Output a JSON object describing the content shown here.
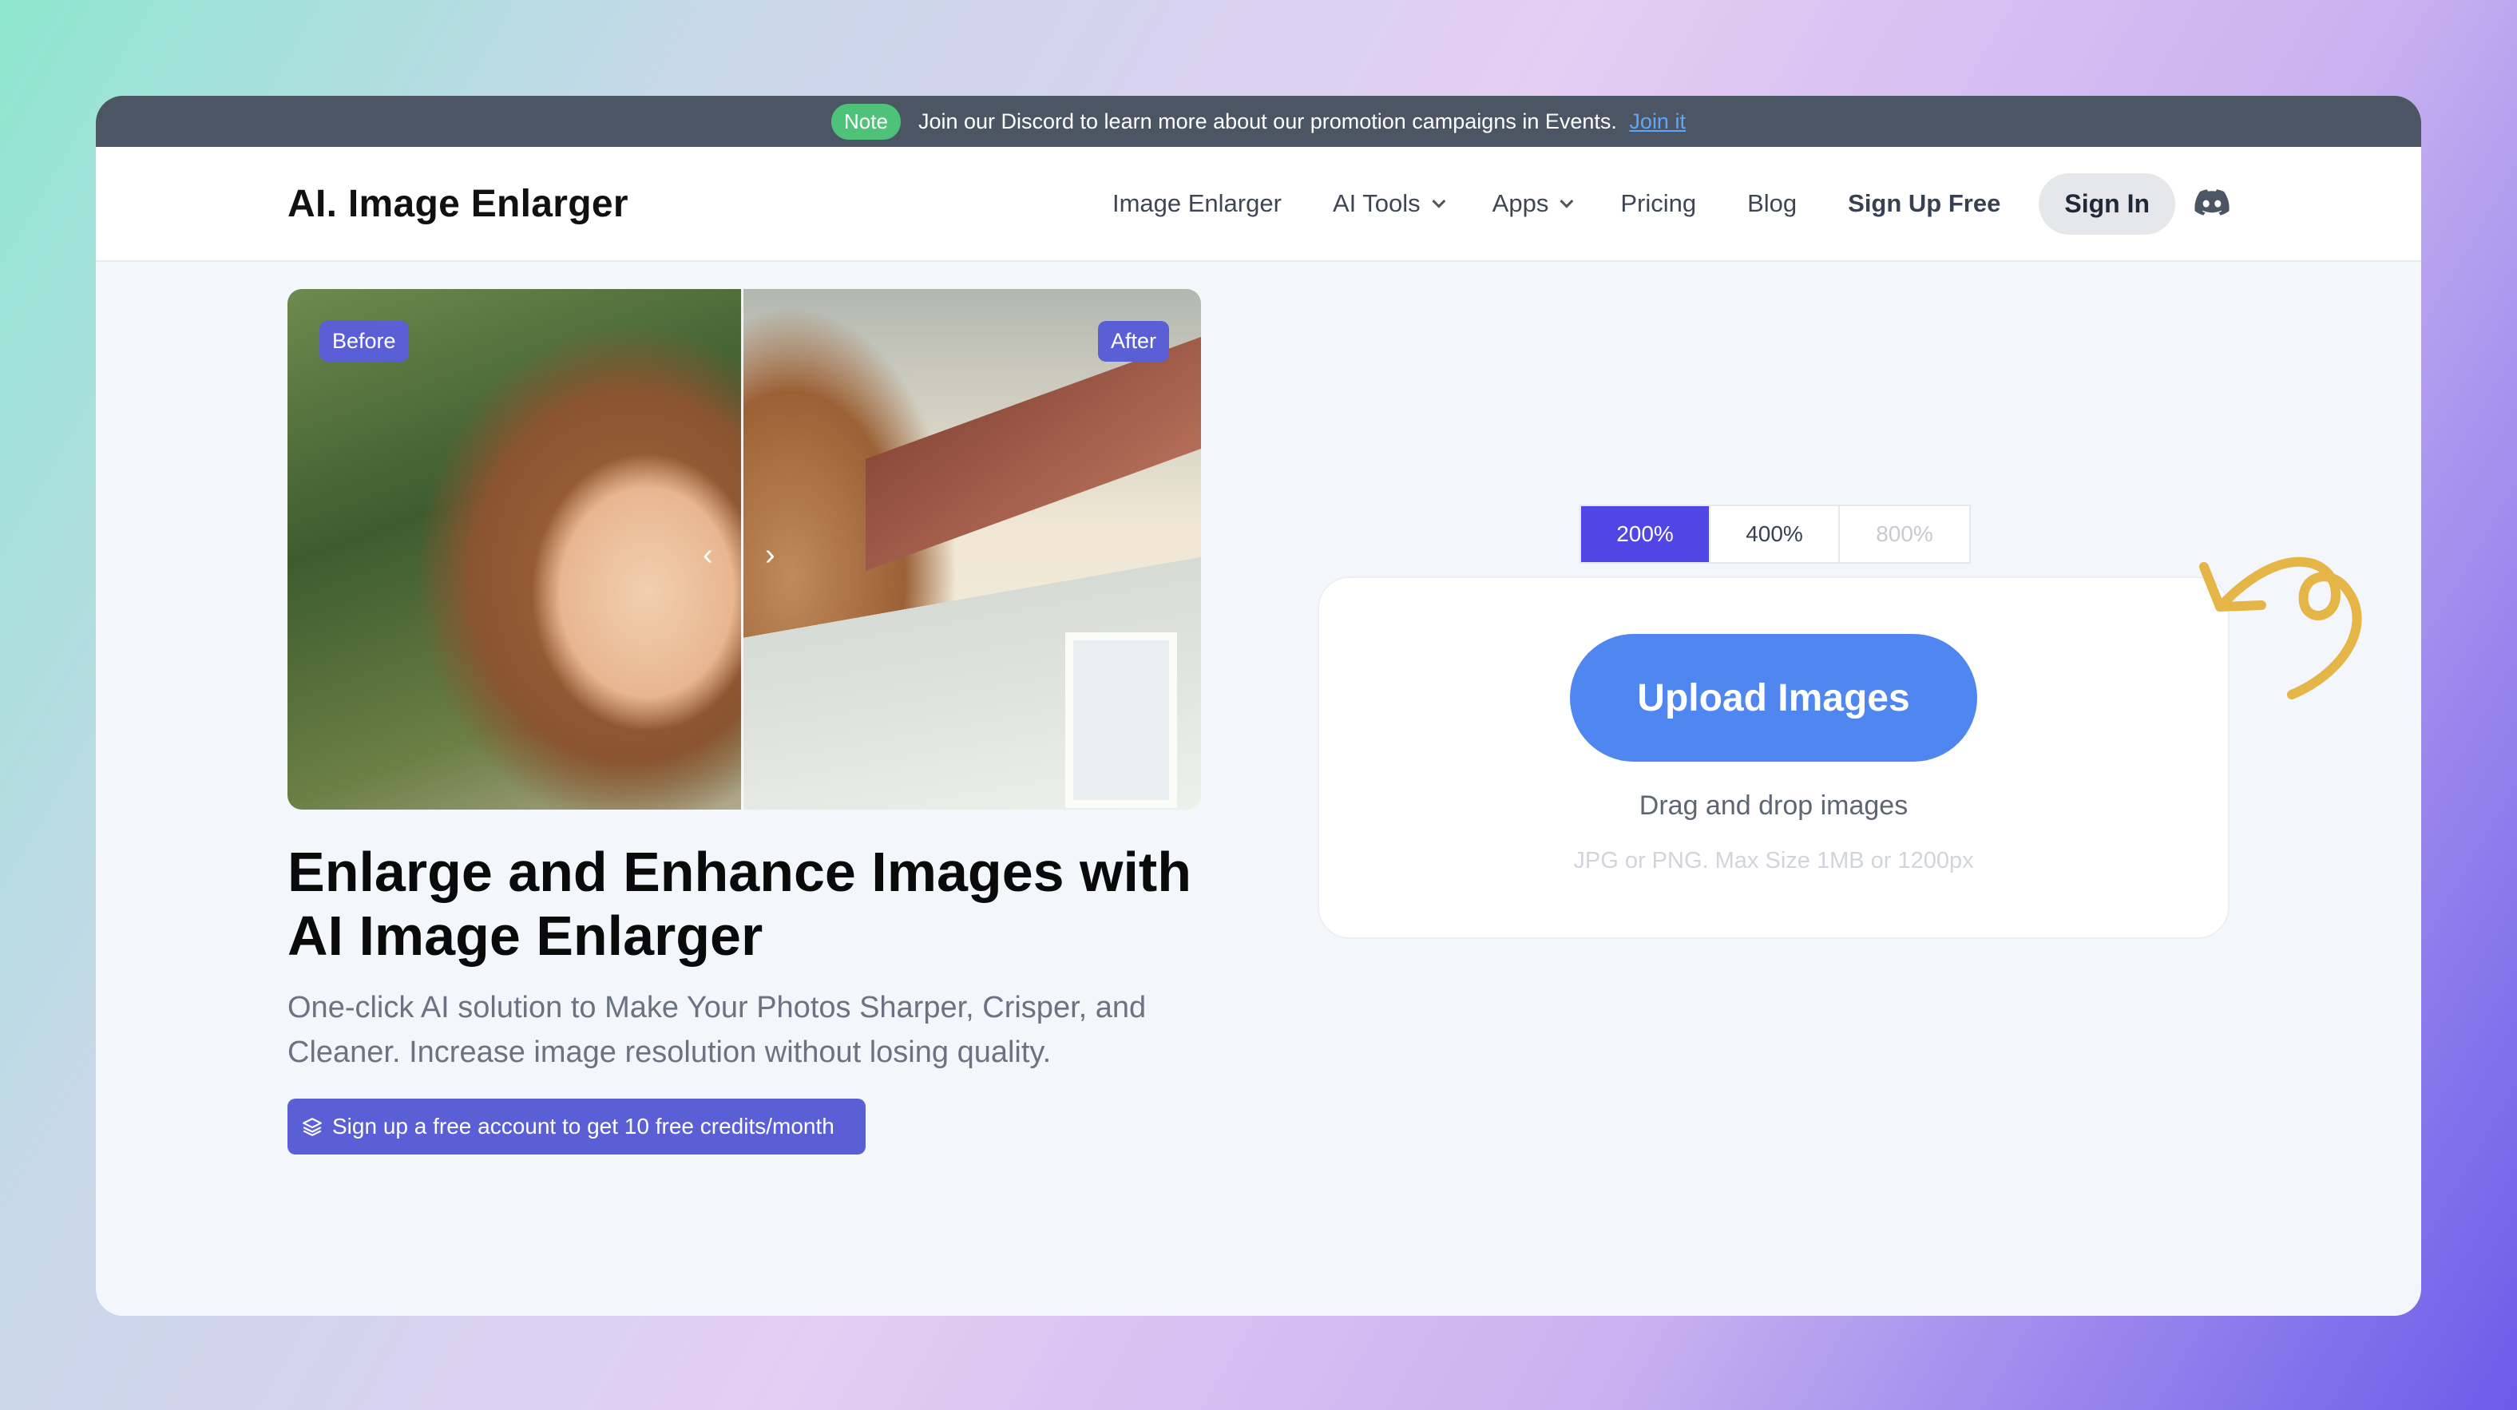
{
  "notice": {
    "badge": "Note",
    "text": "Join our Discord to learn more about our promotion campaigns in Events.",
    "link": "Join it"
  },
  "header": {
    "logo": "AI. Image Enlarger",
    "nav": [
      {
        "label": "Image Enlarger"
      },
      {
        "label": "AI Tools"
      },
      {
        "label": "Apps"
      },
      {
        "label": "Pricing"
      },
      {
        "label": "Blog"
      }
    ],
    "signup": "Sign Up Free",
    "signin": "Sign In"
  },
  "hero": {
    "before": "Before",
    "after": "After",
    "headline": "Enlarge and Enhance Images with AI Image Enlarger",
    "subtitle": "One-click AI solution to Make Your Photos Sharper, Crisper, and Cleaner. Increase image resolution without losing quality.",
    "cta": "Sign up a free account to get 10 free credits/month"
  },
  "upload": {
    "scales": [
      "200%",
      "400%",
      "800%"
    ],
    "selected_scale": "200%",
    "button": "Upload Images",
    "drag": "Drag and drop images",
    "hint": "JPG or PNG. Max Size 1MB or 1200px"
  },
  "colors": {
    "accent": "#4f46e5",
    "upload_button": "#4f86f0",
    "badge_green": "#4fc27a",
    "tag_purple": "#5b5fd6",
    "swirl": "#e6b547"
  }
}
